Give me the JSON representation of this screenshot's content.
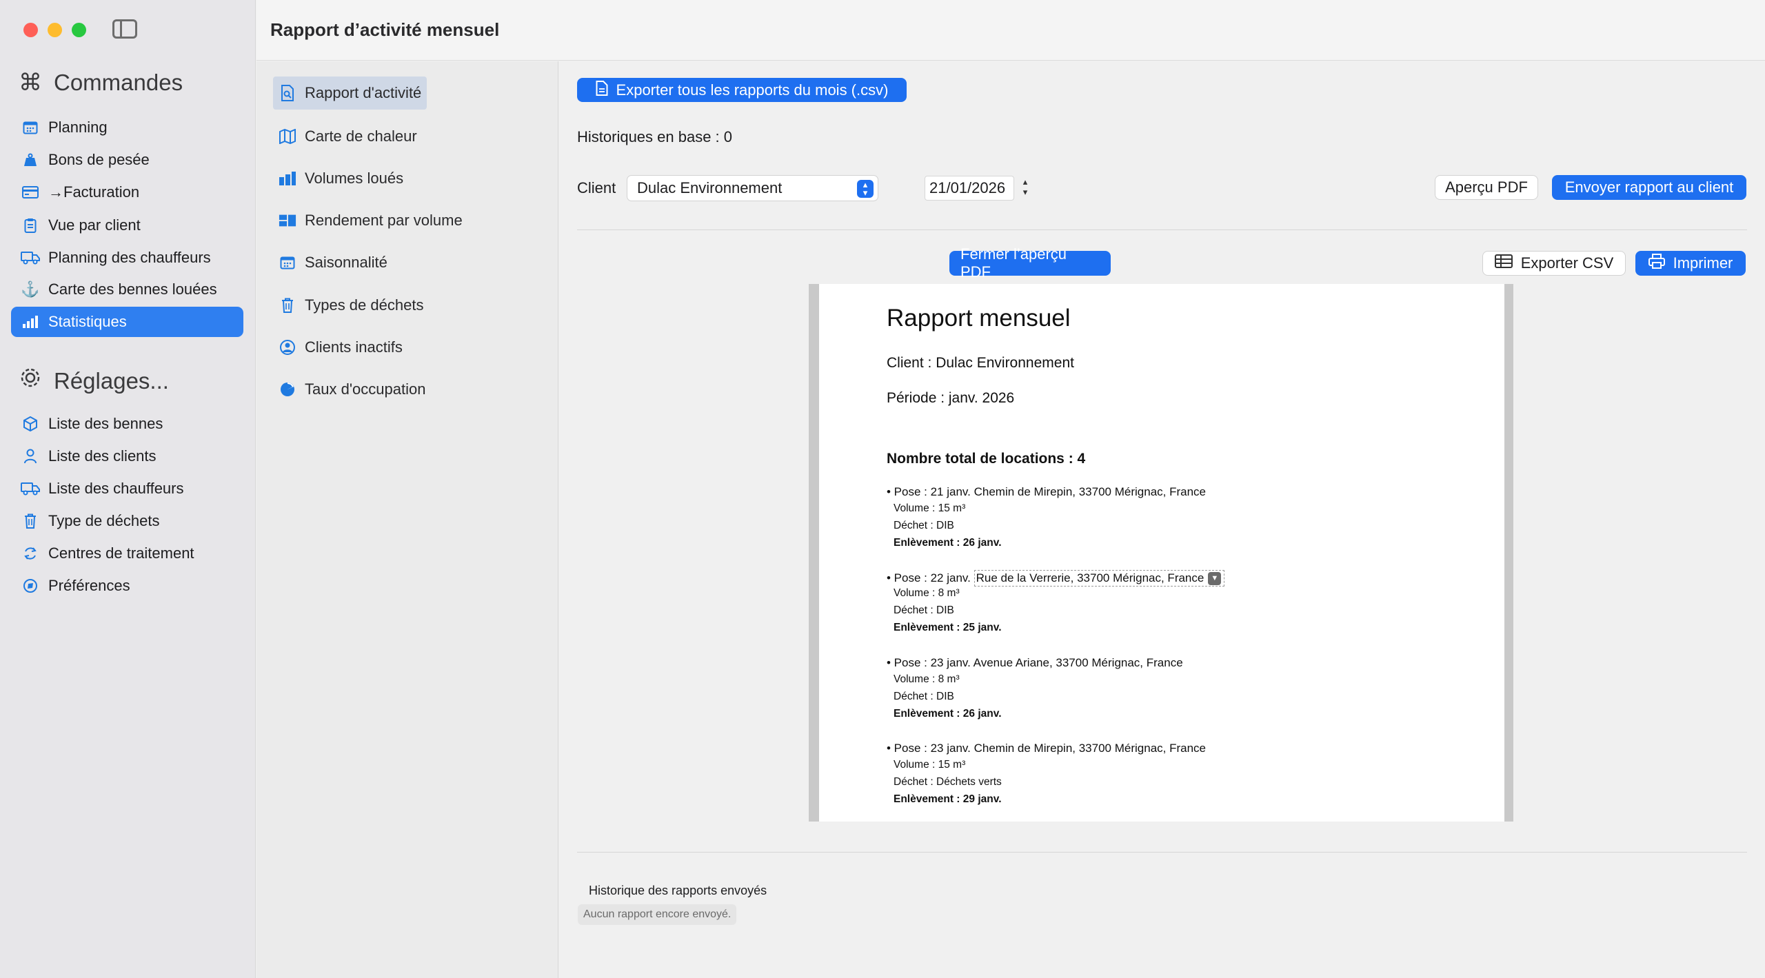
{
  "window": {
    "title": "Rapport d’activité mensuel"
  },
  "sidebar": {
    "section1": {
      "title": "Commandes",
      "icon": "command-icon"
    },
    "section1_items": [
      {
        "label": "Planning",
        "icon": "calendar-icon"
      },
      {
        "label": "Bons de pesée",
        "icon": "weight-icon"
      },
      {
        "label": "→Facturation",
        "icon": "creditcard-icon"
      },
      {
        "label": "Vue par client",
        "icon": "clipboard-icon"
      },
      {
        "label": "Planning des chauffeurs",
        "icon": "truck-icon"
      },
      {
        "label": "Carte des bennes louées",
        "icon": "anchor-icon"
      },
      {
        "label": "Statistiques",
        "icon": "chart-bar-icon",
        "active": true
      }
    ],
    "section2": {
      "title": "Réglages...",
      "icon": "gear-icon"
    },
    "section2_items": [
      {
        "label": "Liste des bennes",
        "icon": "cube-icon"
      },
      {
        "label": "Liste des clients",
        "icon": "person-icon"
      },
      {
        "label": "Liste des chauffeurs",
        "icon": "truck-icon"
      },
      {
        "label": "Type de déchets",
        "icon": "trash-icon"
      },
      {
        "label": "Centres de traitement",
        "icon": "recycle-icon"
      },
      {
        "label": "Préférences",
        "icon": "compass-icon"
      }
    ]
  },
  "subnav": [
    {
      "label": "Rapport d'activité",
      "icon": "report-icon",
      "active": true
    },
    {
      "label": "Carte de chaleur",
      "icon": "map-icon"
    },
    {
      "label": "Volumes loués",
      "icon": "bars-icon"
    },
    {
      "label": "Rendement par volume",
      "icon": "blocks-icon"
    },
    {
      "label": "Saisonnalité",
      "icon": "calendar-icon"
    },
    {
      "label": "Types de déchets",
      "icon": "trash-icon"
    },
    {
      "label": "Clients inactifs",
      "icon": "person-circle-icon"
    },
    {
      "label": "Taux d'occupation",
      "icon": "pie-icon"
    }
  ],
  "main": {
    "export_all_label": "Exporter tous les rapports du mois (.csv)",
    "history_count_text": "Historiques en base : 0",
    "client_label": "Client",
    "client_value": "Dulac Environnement",
    "date_value": "21/01/2026",
    "preview_pdf_label": "Aperçu PDF",
    "send_report_label": "Envoyer rapport au client",
    "close_preview_label": "Fermer l’aperçu PDF",
    "export_csv_label": "Exporter CSV",
    "print_label": "Imprimer",
    "history_title": "Historique des rapports envoyés",
    "history_empty": "Aucun rapport encore envoyé."
  },
  "report": {
    "title": "Rapport mensuel",
    "client_line": "Client : Dulac Environnement",
    "period_line": "Période : janv. 2026",
    "total_line": "Nombre total de locations : 4",
    "locations": [
      {
        "pose": "• Pose : 21 janv. ",
        "address": "Chemin de Mirepin, 33700 Mérignac, France",
        "volume": "Volume : 15 m³",
        "dechet": "Déchet : DIB",
        "enlevement": "Enlèvement : 26 janv.",
        "editable": false
      },
      {
        "pose": "• Pose : 22 janv. ",
        "address": "Rue de la Verrerie, 33700 Mérignac, France",
        "volume": "Volume : 8 m³",
        "dechet": "Déchet : DIB",
        "enlevement": "Enlèvement : 25 janv.",
        "editable": true
      },
      {
        "pose": "• Pose : 23 janv. ",
        "address": "Avenue Ariane, 33700 Mérignac, France",
        "volume": "Volume : 8 m³",
        "dechet": "Déchet : DIB",
        "enlevement": "Enlèvement : 26 janv.",
        "editable": false
      },
      {
        "pose": "• Pose : 23 janv. ",
        "address": "Chemin de Mirepin, 33700 Mérignac, France",
        "volume": "Volume : 15 m³",
        "dechet": "Déchet : Déchets verts",
        "enlevement": "Enlèvement : 29 janv.",
        "editable": false
      }
    ]
  },
  "colors": {
    "accent": "#1e6ff0",
    "sidebar_active": "#2f7ff0"
  }
}
